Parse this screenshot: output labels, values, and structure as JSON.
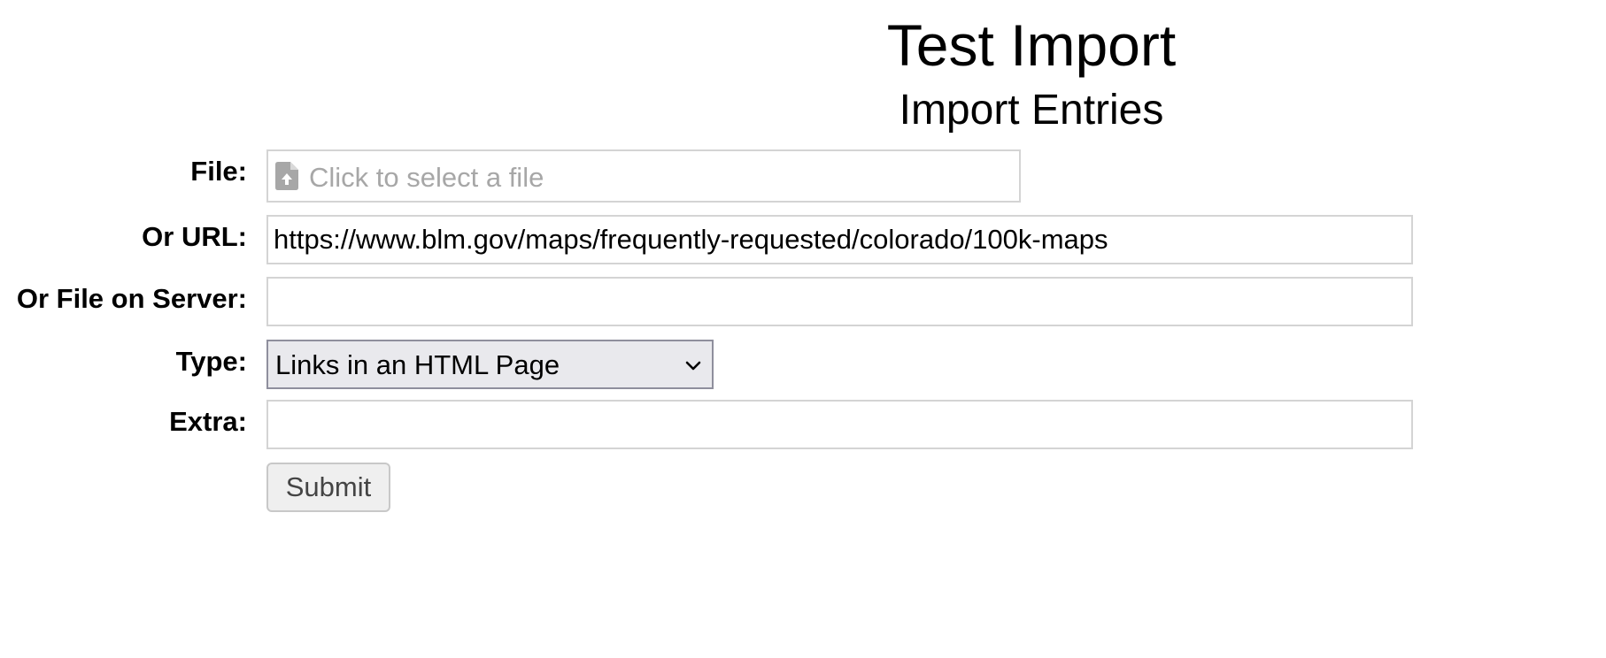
{
  "header": {
    "title": "Test Import",
    "subtitle": "Import Entries"
  },
  "form": {
    "file": {
      "label": "File:",
      "placeholder": "Click to select a file",
      "icon": "file-upload-icon"
    },
    "url": {
      "label": "Or URL:",
      "value": "https://www.blm.gov/maps/frequently-requested/colorado/100k-maps"
    },
    "server_file": {
      "label": "Or File on Server:",
      "value": ""
    },
    "type": {
      "label": "Type:",
      "selected": "Links in an HTML Page",
      "icon": "chevron-down-icon"
    },
    "extra": {
      "label": "Extra:",
      "value": ""
    },
    "submit_label": "Submit"
  },
  "colors": {
    "field_border": "#d4d4d4",
    "placeholder": "#a7a7a7",
    "select_background": "#e9e9ed",
    "button_background": "#efefef"
  }
}
